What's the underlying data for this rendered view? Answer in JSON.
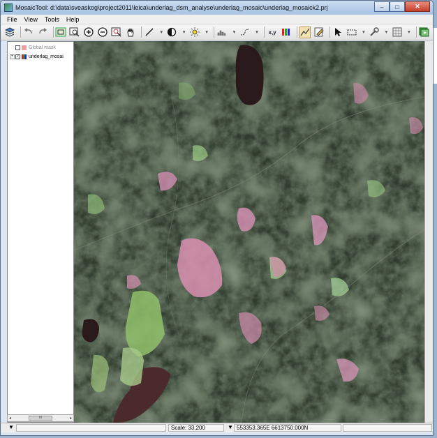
{
  "window": {
    "title": "MosaicTool: d:\\data\\sveaskog\\project2011\\leica\\underlag_dsm_analyse\\underlag_mosaic\\underlag_mosaick2.prj",
    "controls": {
      "minimize": "–",
      "maximize": "□",
      "close": "✕"
    }
  },
  "menu": [
    "File",
    "View",
    "Tools",
    "Help"
  ],
  "toolbar": {
    "xy_label": "x,y",
    "dropdown_glyph": "▾",
    "icons": [
      "layers-icon",
      "undo-icon",
      "redo-icon",
      "zoom-extent-icon",
      "zoom-box-icon",
      "zoom-in-icon",
      "zoom-out-icon",
      "zoom-select-icon",
      "pan-icon",
      "line-draw-icon",
      "contrast-icon",
      "brightness-icon",
      "histogram-icon",
      "stretch-icon",
      "coordinate-icon",
      "bands-icon",
      "seamline-icon",
      "edit-icon",
      "pointer-icon",
      "selection-box-icon",
      "settings-icon",
      "grid-icon",
      "run-mosaic-icon"
    ]
  },
  "layers": [
    {
      "name": "Global mask",
      "checked": false,
      "swatch": "#f0a0a0",
      "expander": "",
      "dimmed": true
    },
    {
      "name": "underlag_mosai",
      "checked": true,
      "swatch": "multiband",
      "expander": "+",
      "dimmed": false
    }
  ],
  "hscroll": {
    "left": "◂",
    "right": "▸",
    "thumb": "III"
  },
  "status": {
    "dropdown_glyph": "▼",
    "scale_label": "Scale: 33,200",
    "coords": "553353.365E 6613750.000N"
  },
  "colors": {
    "water": "#2a1a1c",
    "clearcut": "#d98fb0",
    "field": "#8fbf6a",
    "forest": "#2f3a2c"
  }
}
